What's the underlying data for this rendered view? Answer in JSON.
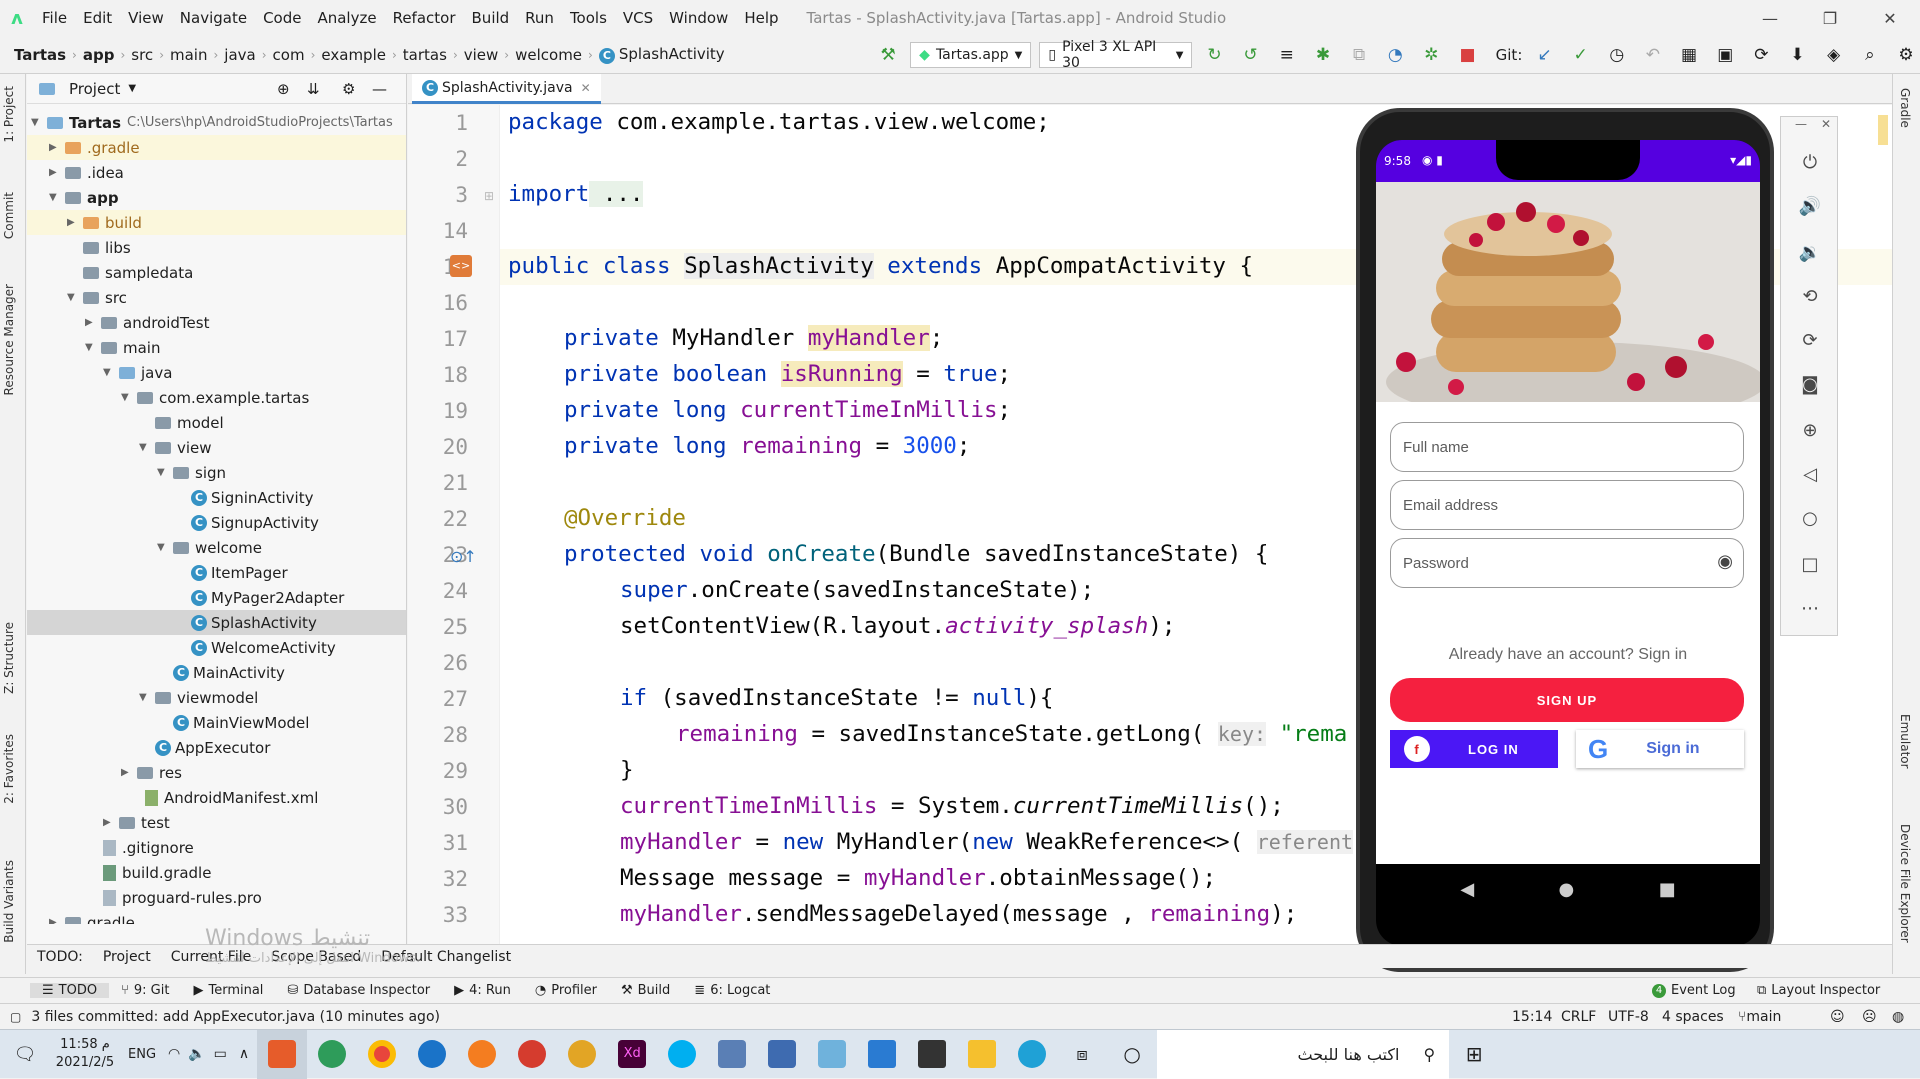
{
  "window": {
    "title": "Tartas - SplashActivity.java [Tartas.app] - Android Studio"
  },
  "menu": [
    "File",
    "Edit",
    "View",
    "Navigate",
    "Code",
    "Analyze",
    "Refactor",
    "Build",
    "Run",
    "Tools",
    "VCS",
    "Window",
    "Help"
  ],
  "breadcrumb": [
    "Tartas",
    "app",
    "src",
    "main",
    "java",
    "com",
    "example",
    "tartas",
    "view",
    "welcome",
    "SplashActivity"
  ],
  "toolbar": {
    "config": "Tartas.app",
    "device": "Pixel 3 XL API 30",
    "git_label": "Git:"
  },
  "project_panel": {
    "title": "Project",
    "root_label": "Tartas",
    "root_path": "C:\\Users\\hp\\AndroidStudioProjects\\Tartas",
    "items": [
      ".gradle",
      ".idea",
      "app",
      "build",
      "libs",
      "sampledata",
      "src",
      "androidTest",
      "main",
      "java",
      "com.example.tartas",
      "model",
      "view",
      "sign",
      "SigninActivity",
      "SignupActivity",
      "welcome",
      "ItemPager",
      "MyPager2Adapter",
      "SplashActivity",
      "WelcomeActivity",
      "MainActivity",
      "viewmodel",
      "MainViewModel",
      "AppExecutor",
      "res",
      "AndroidManifest.xml",
      "test",
      ".gitignore",
      "build.gradle",
      "proguard-rules.pro",
      "gradle"
    ]
  },
  "editor": {
    "tab": "SplashActivity.java",
    "line_numbers": [
      "1",
      "2",
      "3",
      "14",
      "15",
      "16",
      "17",
      "18",
      "19",
      "20",
      "21",
      "22",
      "23",
      "24",
      "25",
      "26",
      "27",
      "28",
      "29",
      "30",
      "31",
      "32",
      "33"
    ],
    "code": {
      "l1a": "package",
      "l1b": " com.example.tartas.view.welcome;",
      "l3a": "import",
      "l3b": " ...",
      "l15a": "public class ",
      "l15b": "SplashActivity",
      "l15c": " extends ",
      "l15d": "AppCompatActivity {",
      "l17a": "private ",
      "l17b": "MyHandler ",
      "l17c": "myHandler",
      "l17d": ";",
      "l18a": "private boolean ",
      "l18b": "isRunning",
      "l18c": " = ",
      "l18d": "true",
      "l18e": ";",
      "l19a": "private long ",
      "l19b": "currentTimeInMillis",
      "l19c": ";",
      "l20a": "private long ",
      "l20b": "remaining",
      "l20c": " = ",
      "l20d": "3000",
      "l20e": ";",
      "l22": "@Override",
      "l23a": "protected void ",
      "l23b": "onCreate",
      "l23c": "(Bundle savedInstanceState) {",
      "l24a": "super",
      "l24b": ".onCreate(savedInstanceState);",
      "l25a": "setContentView(R.layout.",
      "l25b": "activity_splash",
      "l25c": ");",
      "l27a": "if ",
      "l27b": "(savedInstanceState != ",
      "l27c": "null",
      "l27d": "){",
      "l28a": "remaining",
      "l28b": " = savedInstanceState.getLong( ",
      "l28c": "key:",
      "l28d": " \"rema",
      "l29": "}",
      "l30a": "currentTimeInMillis",
      "l30b": " = System.",
      "l30c": "currentTimeMillis",
      "l30d": "();",
      "l31a": "myHandler",
      "l31b": " = ",
      "l31c": "new ",
      "l31d": "MyHandler(",
      "l31e": "new ",
      "l31f": "WeakReference<>( ",
      "l31g": "referent",
      "l32a": "Message message = ",
      "l32b": "myHandler",
      "l32c": ".obtainMessage();",
      "l33a": "myHandler",
      "l33b": ".sendMessageDelayed(message , ",
      "l33c": "remaining",
      "l33d": ");"
    }
  },
  "emulator": {
    "time": "9:58",
    "full_name": "Full name",
    "email": "Email address",
    "password": "Password",
    "already": "Already have an account? Sign in",
    "signup": "SIGN UP",
    "login": "LOG IN",
    "google": "Sign in"
  },
  "left_tabs": [
    "1: Project",
    "Commit",
    "Resource Manager",
    "Z: Structure",
    "2: Favorites",
    "Build Variants"
  ],
  "right_tabs": [
    "Gradle",
    "Emulator",
    "Device File Explorer"
  ],
  "bottom_bar": [
    "TODO:",
    "Project",
    "Current File",
    "Scope Based",
    "Default Changelist"
  ],
  "tool_windows": [
    "TODO",
    "9: Git",
    "Terminal",
    "Database Inspector",
    "4: Run",
    "Profiler",
    "Build",
    "6: Logcat",
    "Event Log",
    "Layout Inspector"
  ],
  "status": {
    "message": "3 files committed: add AppExecutor.java (10 minutes ago)",
    "position": "15:14",
    "line_sep": "CRLF",
    "encoding": "UTF-8",
    "indent": "4 spaces",
    "branch": "main"
  },
  "taskbar": {
    "time": "11:58 م",
    "date": "2021/2/5",
    "lang": "ENG",
    "search": "اكتب هنا للبحث"
  },
  "watermark": {
    "line1": "Windows تنشيط",
    "line2": "انتقل إلى الإعدادات لتنشيط Windows."
  }
}
